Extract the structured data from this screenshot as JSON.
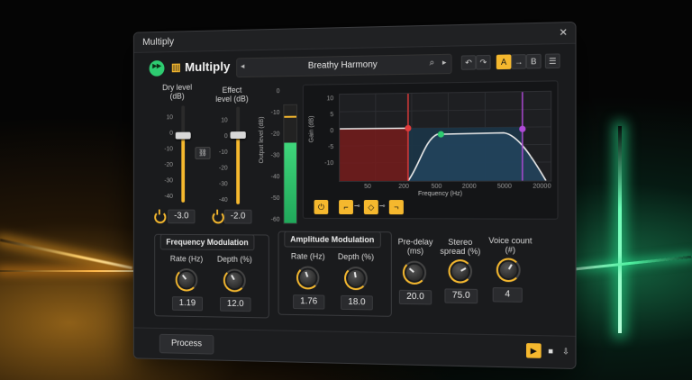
{
  "window": {
    "title": "Multiply",
    "close_glyph": "✕"
  },
  "app": {
    "name": "Multiply",
    "brand_mark": "▥",
    "status_color": "#2ecc71"
  },
  "preset": {
    "name": "Breathy Harmony",
    "prev_glyph": "◂",
    "next_glyph": "▸",
    "search_glyph": "⌕"
  },
  "toolbar": {
    "undo_glyph": "↶",
    "redo_glyph": "↷",
    "a_label": "A",
    "arrow_glyph": "→",
    "b_label": "B",
    "menu_glyph": "☰"
  },
  "faders": {
    "dry": {
      "label_line1": "Dry level",
      "label_line2": "(dB)",
      "value": "-3.0"
    },
    "effect": {
      "label_line1": "Effect",
      "label_line2": "level (dB)",
      "value": "-2.0"
    },
    "scale": [
      "10",
      "0",
      "-10",
      "-20",
      "-30",
      "-40"
    ],
    "link_glyph": "⛓"
  },
  "meter": {
    "label": "Output level (dB)",
    "scale": [
      "0",
      "-10",
      "-20",
      "-30",
      "-40",
      "-50",
      "-60"
    ],
    "level_fraction": 0.68
  },
  "eq": {
    "ylabel": "Gain (dB)",
    "xlabel": "Frequency (Hz)",
    "y_ticks": [
      "10",
      "5",
      "0",
      "-5",
      "-10"
    ],
    "x_ticks": [
      "50",
      "200",
      "500",
      "2000",
      "5000",
      "20000"
    ],
    "buttons": {
      "power": "⏻",
      "lowcut": "⌐",
      "bell": "◇",
      "highcut": "¬",
      "link1": "⊸",
      "link2": "⊸"
    }
  },
  "freq_mod": {
    "title": "Frequency Modulation",
    "rate": {
      "label": "Rate (Hz)",
      "value": "1.19"
    },
    "depth": {
      "label": "Depth (%)",
      "value": "12.0"
    }
  },
  "amp_mod": {
    "title": "Amplitude Modulation",
    "rate": {
      "label": "Rate (Hz)",
      "value": "1.76"
    },
    "depth": {
      "label": "Depth (%)",
      "value": "18.0"
    }
  },
  "voices": {
    "predelay": {
      "label_line1": "Pre-delay",
      "label_line2": "(ms)",
      "value": "20.0"
    },
    "spread": {
      "label_line1": "Stereo",
      "label_line2": "spread (%)",
      "value": "75.0"
    },
    "count": {
      "label_line1": "Voice count",
      "label_line2": "(#)",
      "value": "4"
    }
  },
  "footer": {
    "process_label": "Process",
    "play_glyph": "▶",
    "stop_glyph": "■",
    "export_glyph": "⇩"
  },
  "colors": {
    "accent": "#f5b82e",
    "meter": "#3fd67b",
    "band_low": "#e23b3b",
    "band_mid": "#2ecc71",
    "band_high": "#b04ad8"
  }
}
